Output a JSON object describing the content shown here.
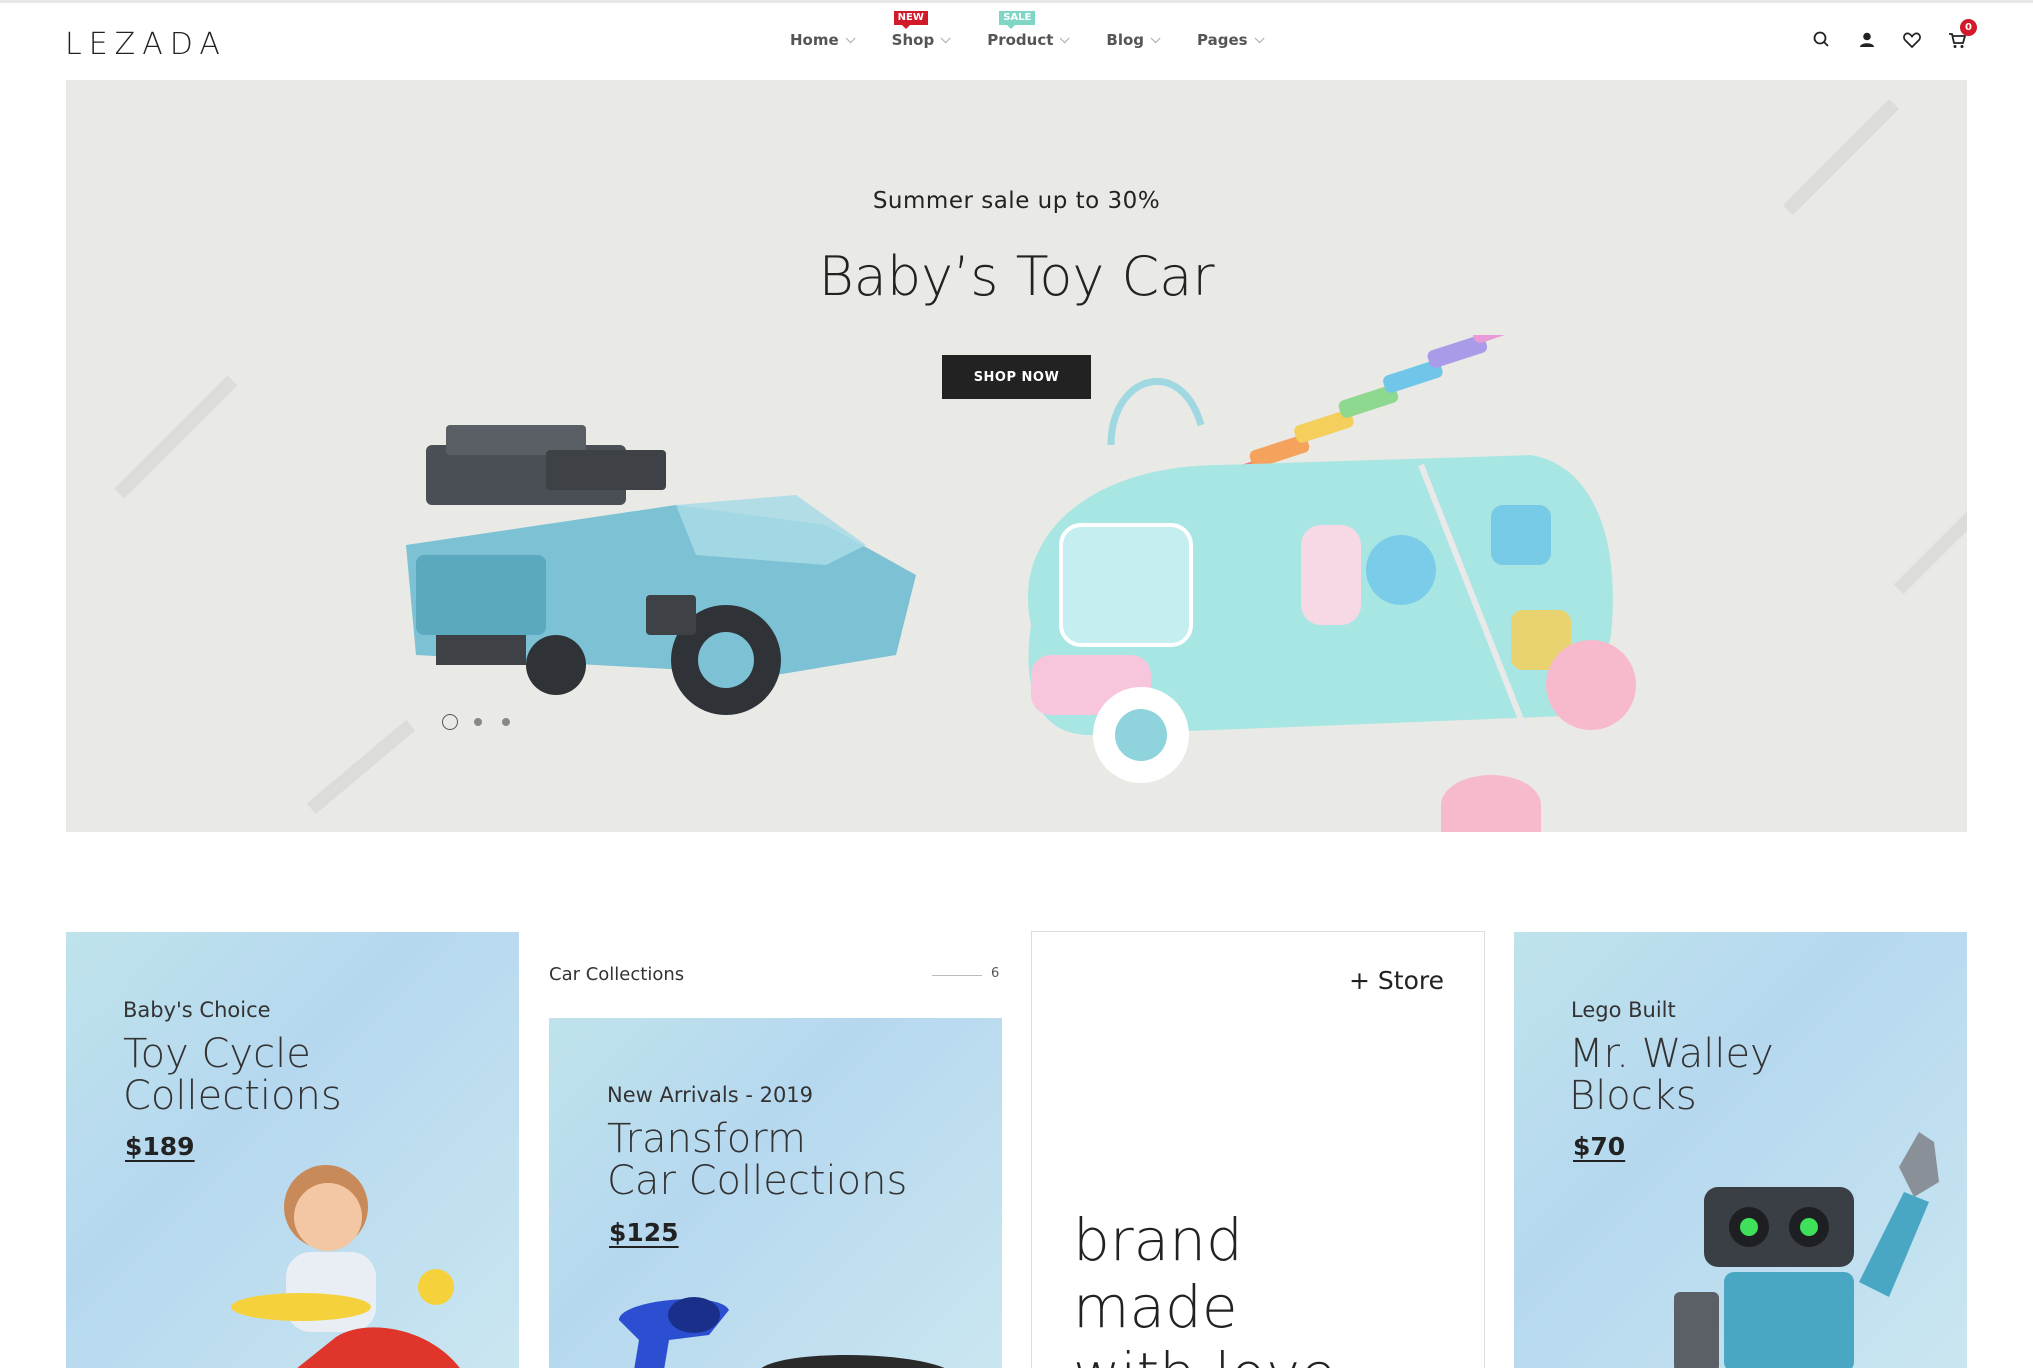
{
  "header": {
    "logo": "LEZADA",
    "nav": [
      {
        "label": "Home",
        "badge": ""
      },
      {
        "label": "Shop",
        "badge": "NEW"
      },
      {
        "label": "Product",
        "badge": "SALE"
      },
      {
        "label": "Blog",
        "badge": ""
      },
      {
        "label": "Pages",
        "badge": ""
      }
    ],
    "cart_count": "0",
    "icons": [
      "search-icon",
      "user-icon",
      "heart-icon",
      "cart-icon"
    ]
  },
  "hero": {
    "subtitle": "Summer sale up to 30%",
    "title": "Baby’s Toy Car",
    "button": "SHOP NOW",
    "slides": 3,
    "active_slide": 1
  },
  "banners": {
    "cycle": {
      "kicker": "Baby's Choice",
      "title_line1": "Toy Cycle",
      "title_line2": "Collections",
      "price": "$189"
    },
    "cars": {
      "heading": "Car Collections",
      "count": "6",
      "kicker": "New Arrivals - 2019",
      "title_line1": "Transform",
      "title_line2": "Car Collections",
      "price": "$125"
    },
    "store": {
      "link": "+ Store",
      "slogan_line1": "brand",
      "slogan_line2": "made",
      "slogan_line3": "with love"
    },
    "lego": {
      "kicker": "Lego Built",
      "title_line1": "Mr. Walley",
      "title_line2": "Blocks",
      "price": "$70"
    }
  },
  "colors": {
    "accent_red": "#d11a2a",
    "sale_teal": "#7fd6c4",
    "hero_bg": "#e9e9e5",
    "banner_blue": "#bfe3ec"
  }
}
